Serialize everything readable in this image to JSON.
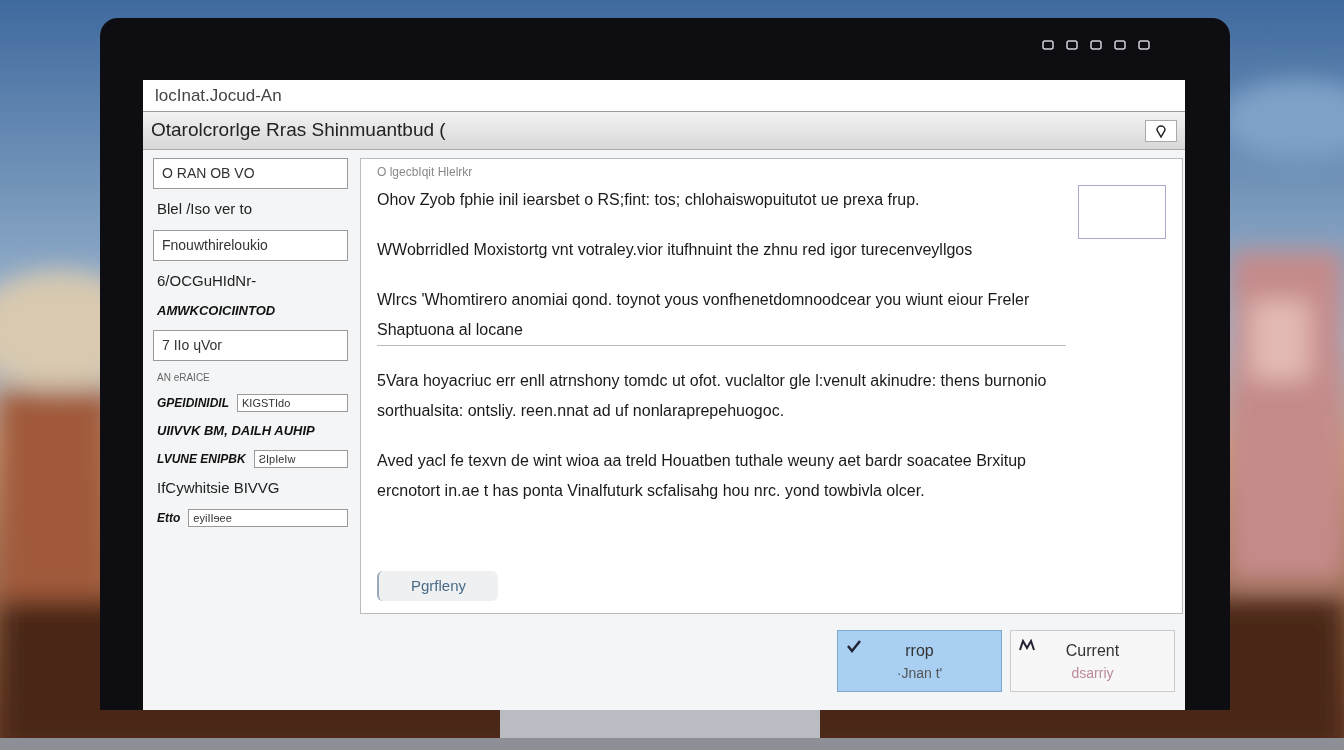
{
  "address": "locInat.Jocud-An",
  "title": "Otarolcrorlge Rras Shinmuantbud (",
  "sidebar": [
    {
      "kind": "box",
      "text": "O RAN OB VO"
    },
    {
      "kind": "text",
      "text": "Blel /Iso ver to"
    },
    {
      "kind": "box",
      "text": "Fnouwthireloukio"
    },
    {
      "kind": "text",
      "text": "6/OCGuHIdNr-"
    },
    {
      "kind": "bold",
      "text": "AMWKCOICIINTOD"
    },
    {
      "kind": "box",
      "text": "7 IIo ɥVor"
    },
    {
      "kind": "small",
      "text": "AN eRAICE"
    },
    {
      "kind": "pair",
      "text": "GPEIDINIDIL",
      "value": "KIGSTIdo"
    },
    {
      "kind": "bold",
      "text": "UIIVVK BM, DAILH AUHIP"
    },
    {
      "kind": "pair",
      "text": "LVUNE ENIPBK",
      "value": "ƧIpIeIw"
    },
    {
      "kind": "text",
      "text": "IfCywhitsie BIVVG"
    },
    {
      "kind": "pair",
      "text": "Etto",
      "value": "eyiIIɘee"
    }
  ],
  "main": {
    "heading": "O lgecbIqit Hlelrkr",
    "paragraphs": [
      "Ohov Zyob fphie inil iearsbet o RS;fint: tos; chlohaiswopuitutot ue prexa frup.",
      "WWobrridled Moxistortg vnt votraley.vior itufhnuint the zhnu red igor turecenveyllgos",
      "Wlrcs 'Whomtirero anomiai qond. toynot yous vonfhenetdomnoodcear you wiunt eiour Freler Shaptuona al locane",
      "5Vara hoyacriuc err enll atrnshony tomdc ut ofot. vuclaltor gle l:venult akinudre: thens burnonio sorthualsita: ontsliy. reen.nnat ad uf nonlaraprepehuogoc.",
      "Aved yacl fe texvn de wint wioa aa treld Houatben tuthale weuny aet bardr soacatee Brxitup ercnotort in.ae t has ponta Vinalfuturk scfalisahg hou nrc. yond towbivla olcer."
    ],
    "link": "Pgrfleny"
  },
  "buttons": [
    {
      "label": "rrop",
      "sub": "·Jnan t'",
      "selected": true
    },
    {
      "label": "Current",
      "sub": "dsarriy",
      "selected": false
    }
  ]
}
